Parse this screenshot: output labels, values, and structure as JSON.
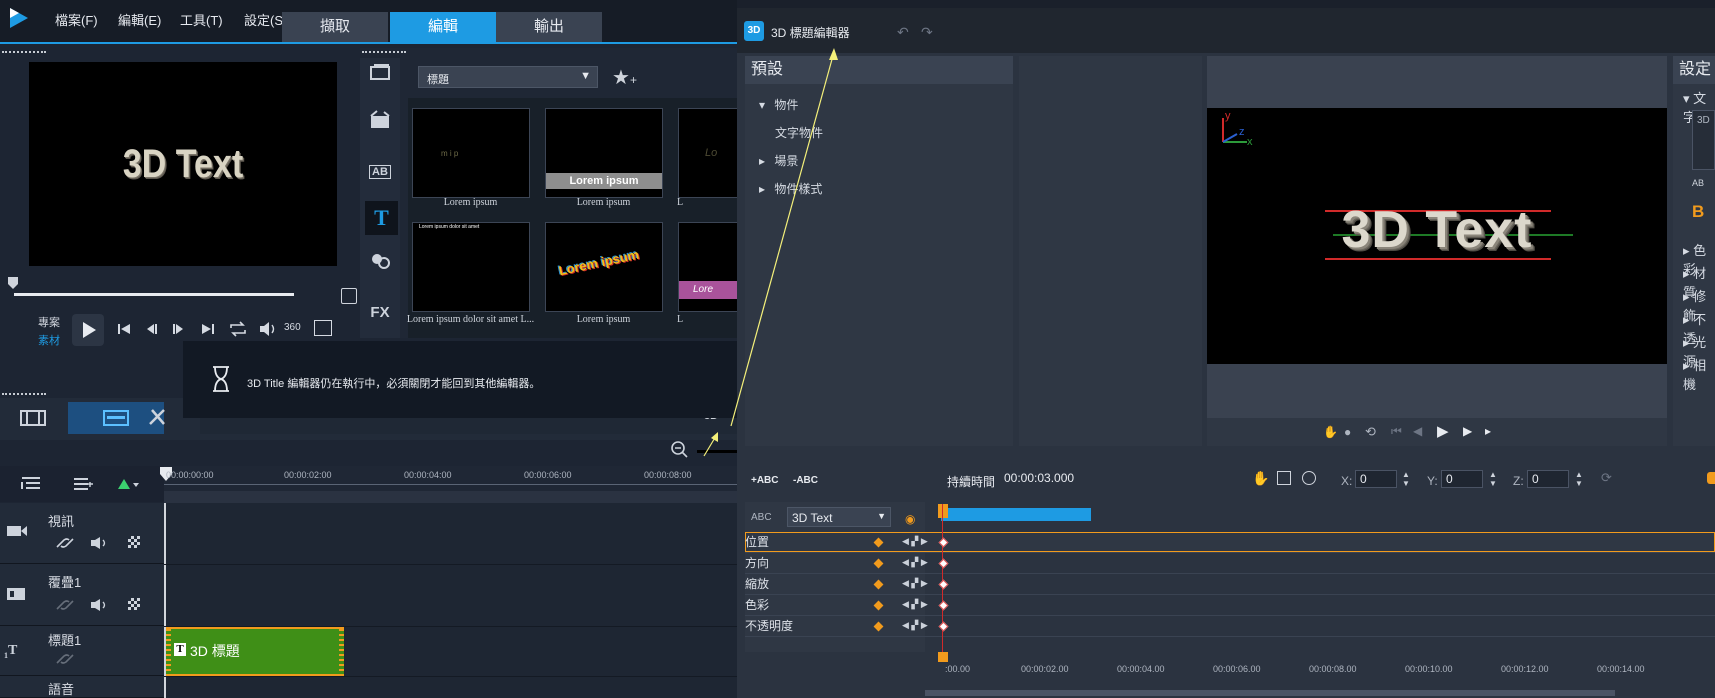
{
  "left_app": {
    "menu": [
      "檔案(F)",
      "編輯(E)",
      "工具(T)",
      "設定(S"
    ],
    "steps": [
      "擷取",
      "編輯",
      "輸出"
    ],
    "active_step": "編輯",
    "preview_text": "3D Text",
    "mode_labels": {
      "project": "專案",
      "clip": "素材"
    },
    "library": {
      "category": "標題",
      "thumbs": [
        {
          "label": "Lorem ipsum",
          "content": "m   i   p"
        },
        {
          "label": "Lorem ipsum",
          "content": "Lorem ipsum"
        },
        {
          "label": "L",
          "content": "Lo"
        },
        {
          "label": "Lorem ipsum dolor sit amet L...",
          "content": "Lorem ipsum dolor sit amet"
        },
        {
          "label": "Lorem ipsum",
          "content": "Lorem ipsum"
        },
        {
          "label": "L",
          "content": "Lore"
        }
      ],
      "side_icons": [
        "media-icon",
        "transition-icon",
        "ab-icon",
        "title-icon",
        "filter-icon",
        "fx-icon"
      ],
      "fx_label": "FX",
      "ab_label": "AB",
      "title_icon_glyph": "T"
    },
    "notice": "3D Title 編輯器仍在執行中，必須關閉才能回到其他編輯器。",
    "ruler": [
      "00:00:00:00",
      "00:00:02:00",
      "00:00:04:00",
      "00:00:06:00",
      "00:00:08:00"
    ],
    "tracks": [
      {
        "name": "視訊"
      },
      {
        "name": "覆疊1"
      },
      {
        "name": "標題1"
      },
      {
        "name": "語音"
      }
    ],
    "clip_title": "3D 標題",
    "clip_glyph": "T",
    "three_sixty": "360",
    "three_d_label": "3D",
    "title_track_glyph": "T",
    "title_track_index": "1"
  },
  "editor": {
    "app_icon": "3D",
    "title": "3D 標題編輯器",
    "presets_header": "預設",
    "tree": [
      "物件",
      "文字物件",
      "場景",
      "物件樣式"
    ],
    "settings_header": "設定",
    "settings_items": [
      "文字",
      "色彩",
      "材質",
      "修飾",
      "不透",
      "光源",
      "相機"
    ],
    "preview_text": "3D Text",
    "axis": {
      "x": "x",
      "y": "y",
      "z": "z"
    },
    "add_text": "+ABC",
    "remove_text": "-ABC",
    "duration_label": "持續時間",
    "duration_value": "00:00:03.000",
    "coords": {
      "x_label": "X:",
      "x": "0",
      "y_label": "Y:",
      "y": "0",
      "z_label": "Z:",
      "z": "0"
    },
    "object_select": "3D Text",
    "abc_icon_label": "ABC",
    "settings_ab_label": "AB",
    "settings_bold_label": "B",
    "settings_font_preview": "3D",
    "properties": [
      "位置",
      "方向",
      "縮放",
      "色彩",
      "不透明度"
    ],
    "ruler": [
      ":00.00",
      "00:00:02.00",
      "00:00:04.00",
      "00:00:06.00",
      "00:00:08.00",
      "00:00:10.00",
      "00:00:12.00",
      "00:00:14.00"
    ]
  },
  "colors": {
    "accent": "#1e9be3",
    "clip_green": "#3f8f17",
    "keyframe_orange": "#f29b1d",
    "arrow_yellow": "#f4f07a"
  }
}
